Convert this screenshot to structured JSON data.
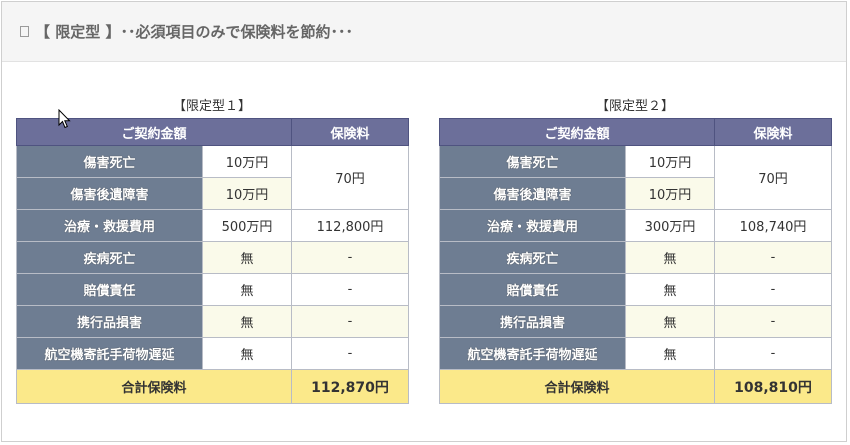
{
  "header": {
    "title": "【 限定型 】･･必須項目のみで保険料を節約･･･"
  },
  "table_headers": {
    "amount": "ご契約金額",
    "premium": "保険料"
  },
  "total_label": "合計保険料",
  "plans": [
    {
      "title": "【限定型１】",
      "death_label": "傷害死亡",
      "death_value": "10万円",
      "disability_label": "傷害後遺障害",
      "disability_value": "10万円",
      "combined_premium": "70円",
      "rows": [
        {
          "label": "治療・救援費用",
          "value": "500万円",
          "premium": "112,800円"
        },
        {
          "label": "疾病死亡",
          "value": "無",
          "premium": "-"
        },
        {
          "label": "賠償責任",
          "value": "無",
          "premium": "-"
        },
        {
          "label": "携行品損害",
          "value": "無",
          "premium": "-"
        },
        {
          "label": "航空機寄託手荷物遅延",
          "value": "無",
          "premium": "-"
        }
      ],
      "total": "112,870円"
    },
    {
      "title": "【限定型２】",
      "death_label": "傷害死亡",
      "death_value": "10万円",
      "disability_label": "傷害後遺障害",
      "disability_value": "10万円",
      "combined_premium": "70円",
      "rows": [
        {
          "label": "治療・救援費用",
          "value": "300万円",
          "premium": "108,740円"
        },
        {
          "label": "疾病死亡",
          "value": "無",
          "premium": "-"
        },
        {
          "label": "賠償責任",
          "value": "無",
          "premium": "-"
        },
        {
          "label": "携行品損害",
          "value": "無",
          "premium": "-"
        },
        {
          "label": "航空機寄託手荷物遅延",
          "value": "無",
          "premium": "-"
        }
      ],
      "total": "108,810円"
    }
  ]
}
